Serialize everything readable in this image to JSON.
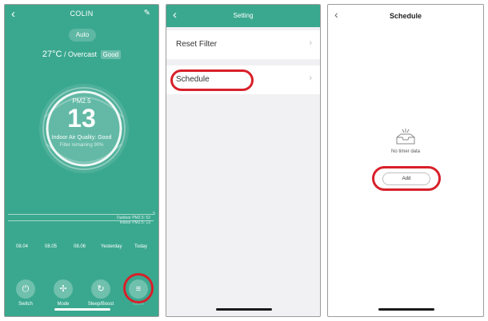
{
  "screen1": {
    "title": "COLIN",
    "mode": "Auto",
    "temperature": "27°C",
    "weather_sep": " / ",
    "weather": "Overcast",
    "quality_badge": "Good",
    "pm_label": "PM2.5",
    "pm_value": "13",
    "air_quality": "Indoor Air Quality: Good",
    "refresh_note": "Filter remaining 90%",
    "graph_outdoor": "Outdoor PM2.5: 52",
    "graph_indoor": "Indoor PM2.5: 13",
    "graph_marker": "5",
    "days": [
      "08.04",
      "08.05",
      "08.06",
      "Yesterday",
      "Today"
    ],
    "controls": [
      {
        "label": "Switch",
        "icon": "power-icon"
      },
      {
        "label": "Mode",
        "icon": "fan-icon"
      },
      {
        "label": "Sleep/Boost",
        "icon": "timer-icon"
      },
      {
        "label": "More",
        "icon": "menu-icon"
      }
    ]
  },
  "screen2": {
    "title": "Setting",
    "items": [
      {
        "label": "Reset Filter"
      },
      {
        "label": "Schedule"
      }
    ]
  },
  "screen3": {
    "title": "Schedule",
    "empty_text": "No timer data",
    "add_label": "Add"
  },
  "colors": {
    "teal": "#3aa88f",
    "highlight": "#d8202a",
    "settings_bg": "#f1f1f3"
  }
}
